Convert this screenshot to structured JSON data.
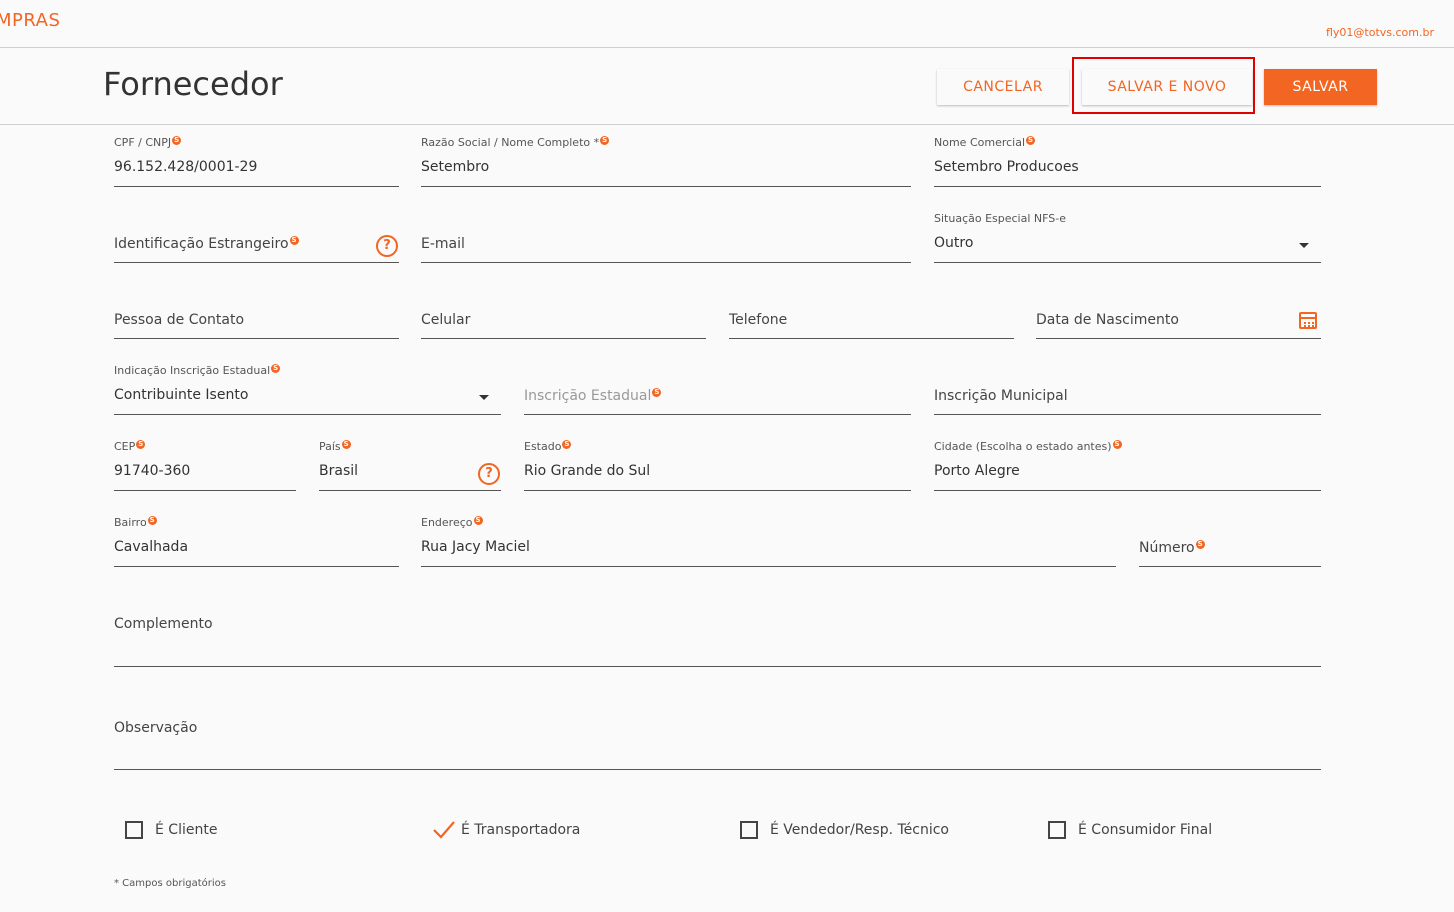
{
  "topbar": {
    "app_name": "MPRAS",
    "user_email": "fly01@totvs.com.br"
  },
  "header": {
    "title": "Fornecedor",
    "cancel_label": "CANCELAR",
    "save_new_label": "SALVAR E NOVO",
    "save_label": "SALVAR"
  },
  "required_mark": "S",
  "fields": {
    "cpf_cnpj": {
      "label": "CPF / CNPJ",
      "value": "96.152.428/0001-29"
    },
    "razao_social": {
      "label": "Razão Social / Nome Completo *",
      "value": "Setembro"
    },
    "nome_comercial": {
      "label": "Nome Comercial",
      "value": "Setembro Producoes"
    },
    "identificacao_estrangeiro": {
      "placeholder": "Identificação Estrangeiro"
    },
    "email": {
      "placeholder": "E-mail"
    },
    "situacao_especial": {
      "label": "Situação Especial NFS-e",
      "value": "Outro"
    },
    "pessoa_contato": {
      "placeholder": "Pessoa de Contato"
    },
    "celular": {
      "placeholder": "Celular"
    },
    "telefone": {
      "placeholder": "Telefone"
    },
    "data_nascimento": {
      "placeholder": "Data de Nascimento"
    },
    "indicacao_ie": {
      "label": "Indicação Inscrição Estadual",
      "value": "Contribuinte Isento"
    },
    "inscricao_estadual": {
      "placeholder": "Inscrição Estadual"
    },
    "inscricao_municipal": {
      "placeholder": "Inscrição Municipal"
    },
    "cep": {
      "label": "CEP",
      "value": "91740-360"
    },
    "pais": {
      "label": "País",
      "value": "Brasil"
    },
    "estado": {
      "label": "Estado",
      "value": "Rio Grande do Sul"
    },
    "cidade": {
      "label": "Cidade (Escolha o estado antes)",
      "value": "Porto Alegre"
    },
    "bairro": {
      "label": "Bairro",
      "value": "Cavalhada"
    },
    "endereco": {
      "label": "Endereço",
      "value": "Rua Jacy Maciel"
    },
    "numero": {
      "placeholder": "Número"
    },
    "complemento": {
      "placeholder": "Complemento"
    },
    "observacao": {
      "placeholder": "Observação"
    }
  },
  "checkboxes": {
    "cliente": {
      "label": "É Cliente",
      "checked": false
    },
    "transportadora": {
      "label": "É Transportadora",
      "checked": true
    },
    "vendedor": {
      "label": "É Vendedor/Resp. Técnico",
      "checked": false
    },
    "consumidor": {
      "label": "É Consumidor Final",
      "checked": false
    }
  },
  "footnote": "* Campos obrigatórios",
  "colors": {
    "accent": "#f26522",
    "highlight": "#e00000"
  }
}
